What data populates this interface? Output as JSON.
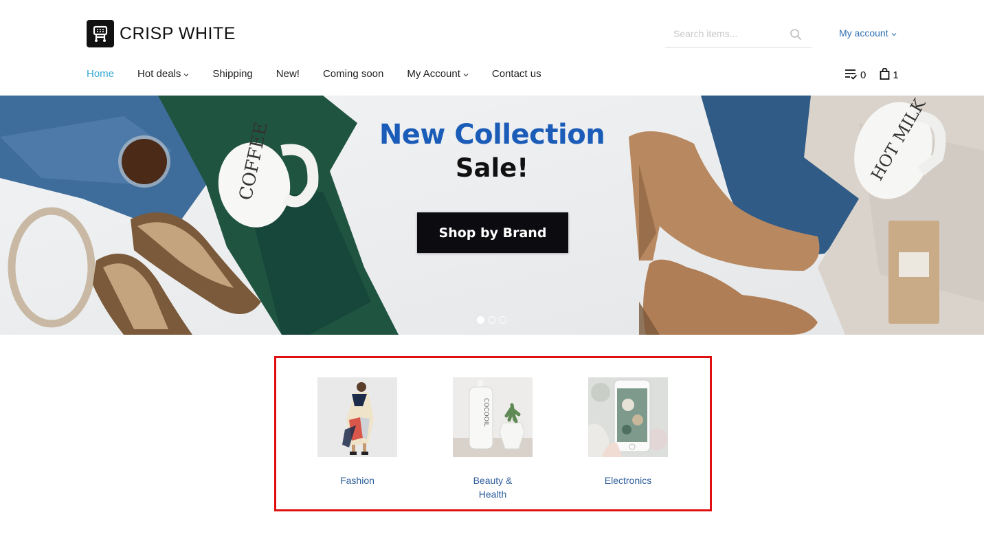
{
  "brand": {
    "name": "CRISP WHITE"
  },
  "search": {
    "placeholder": "Search items..."
  },
  "account": {
    "label": "My account"
  },
  "nav": {
    "items": [
      {
        "label": "Home",
        "active": true,
        "dropdown": false
      },
      {
        "label": "Hot deals",
        "active": false,
        "dropdown": true
      },
      {
        "label": "Shipping",
        "active": false,
        "dropdown": false
      },
      {
        "label": "New!",
        "active": false,
        "dropdown": false
      },
      {
        "label": "Coming soon",
        "active": false,
        "dropdown": false
      },
      {
        "label": "My Account",
        "active": false,
        "dropdown": true
      },
      {
        "label": "Contact us",
        "active": false,
        "dropdown": false
      }
    ]
  },
  "header_counters": {
    "wishlist_count": "0",
    "cart_count": "1"
  },
  "hero": {
    "heading": "New Collection",
    "subheading": "Sale!",
    "button_label": "Shop by Brand",
    "slides_total": 3,
    "active_slide": 1
  },
  "categories": [
    {
      "label": "Fashion"
    },
    {
      "label": "Beauty & Health"
    },
    {
      "label": "Electronics"
    }
  ],
  "colors": {
    "accent": "#35a9d4",
    "link": "#2f6fb0",
    "hero_heading": "#1a5cb8",
    "highlight_border": "#e01010"
  }
}
